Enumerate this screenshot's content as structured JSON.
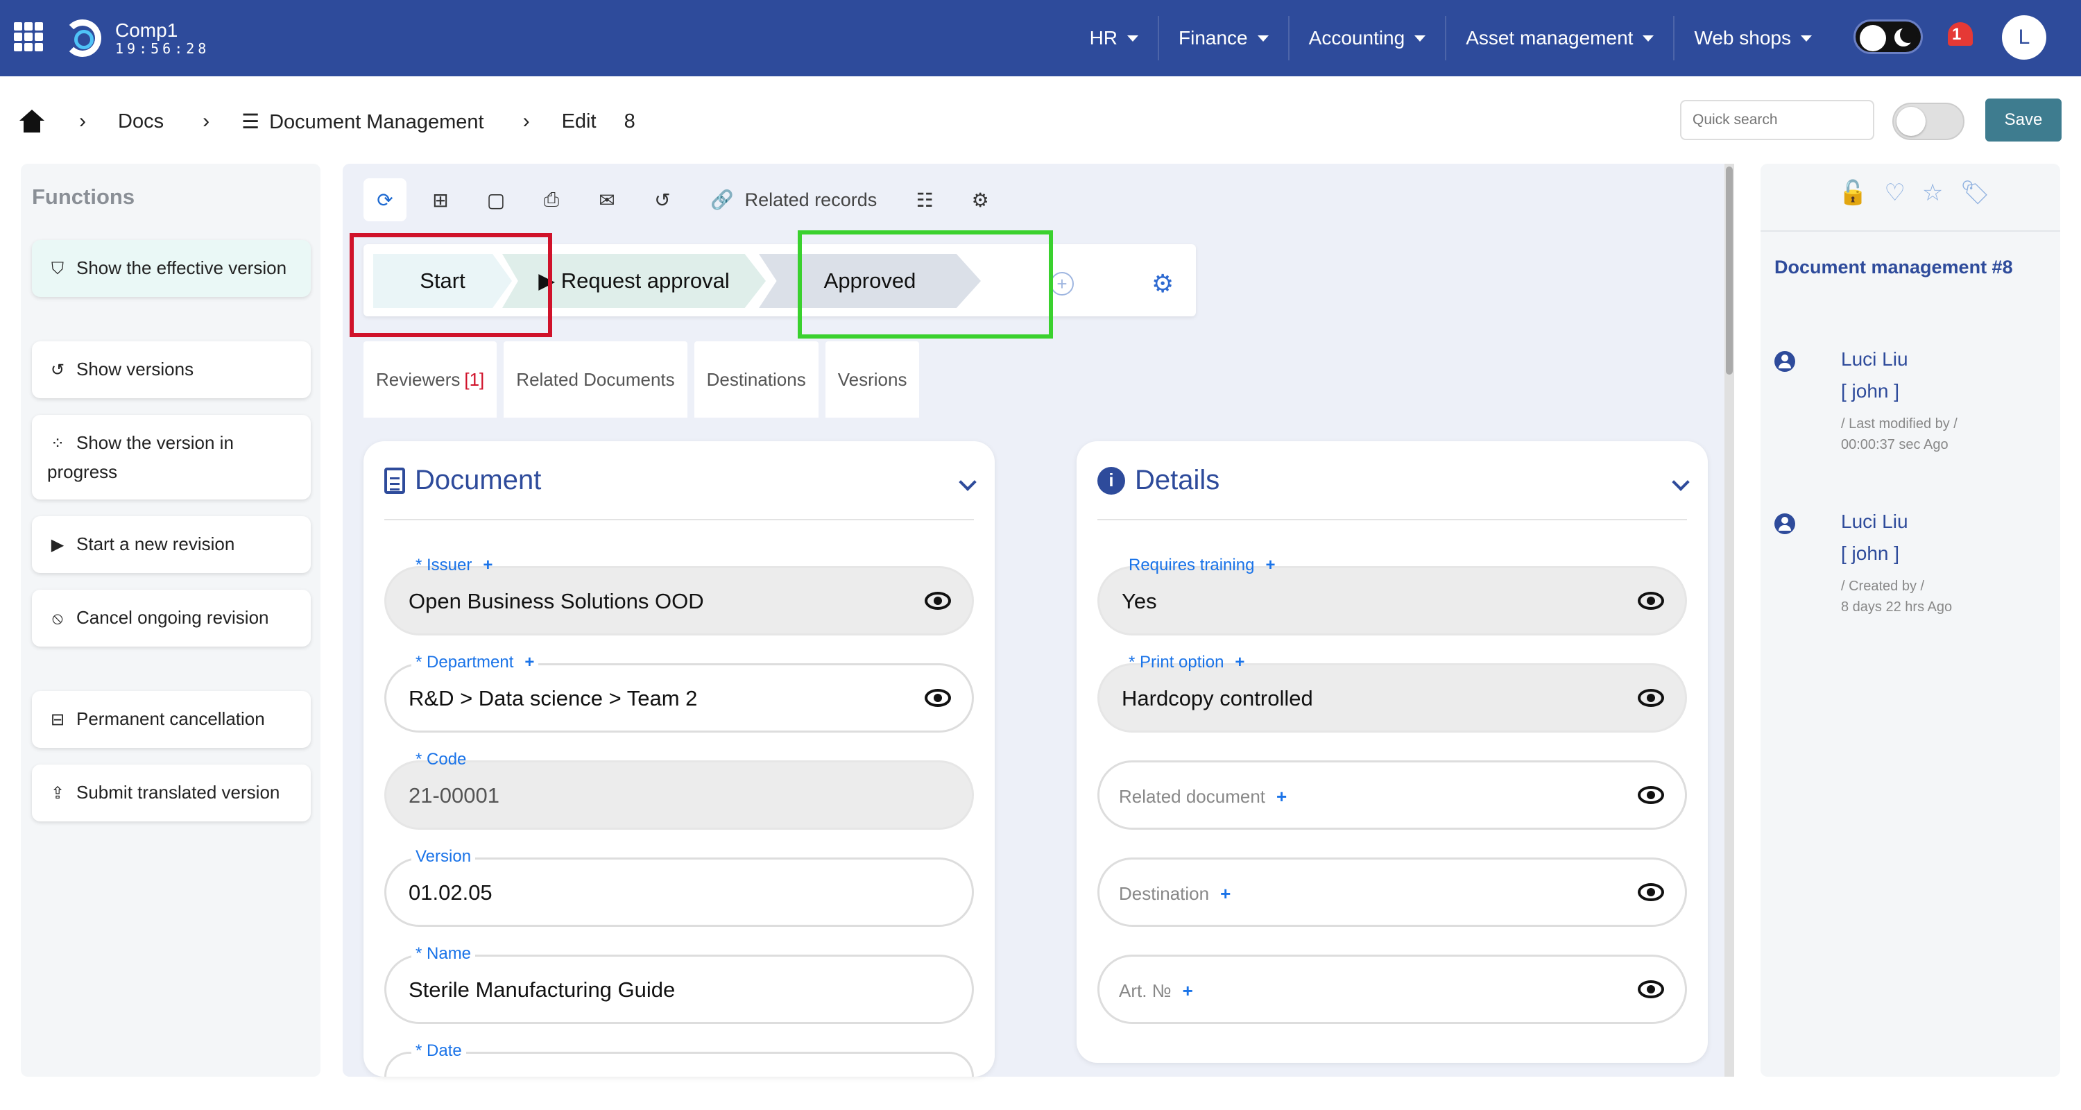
{
  "topbar": {
    "company": "Comp1",
    "time": "19:56:28",
    "nav": [
      "HR",
      "Finance",
      "Accounting",
      "Asset management",
      "Web shops"
    ],
    "notifications": "1",
    "avatar": "L"
  },
  "breadcrumb": {
    "items": [
      "Docs",
      "Document Management",
      "Edit"
    ],
    "record_id": "8"
  },
  "header": {
    "search_placeholder": "Quick search",
    "save_label": "Save"
  },
  "functions": {
    "title": "Functions",
    "items": [
      {
        "label": "Show the effective version",
        "icon": "shield-icon"
      },
      {
        "label": "Show versions",
        "icon": "history-icon"
      },
      {
        "label": "Show the version in progress",
        "icon": "spinner-icon"
      },
      {
        "label": "Start a new revision",
        "icon": "play-icon"
      },
      {
        "label": "Cancel ongoing revision",
        "icon": "ban-icon"
      },
      {
        "label": "Permanent cancellation",
        "icon": "minus-square-icon"
      },
      {
        "label": "Submit translated version",
        "icon": "upload-icon"
      }
    ]
  },
  "toolbar": {
    "related_label": "Related records"
  },
  "workflow": {
    "steps": [
      "Start",
      "▶ Request approval",
      "Approved"
    ]
  },
  "tabs": [
    {
      "label": "Reviewers",
      "badge": "[1]"
    },
    {
      "label": "Related Documents"
    },
    {
      "label": "Destinations"
    },
    {
      "label": "Vesrions"
    }
  ],
  "document": {
    "title": "Document",
    "fields": [
      {
        "label": "* Issuer",
        "value": "Open Business Solutions OOD"
      },
      {
        "label": "* Department",
        "value": "R&D > Data science > Team 2"
      },
      {
        "label": "* Code",
        "value": "21-00001"
      },
      {
        "label": "Version",
        "value": "01.02.05"
      },
      {
        "label": "* Name",
        "value": "Sterile Manufacturing Guide"
      },
      {
        "label": "* Date",
        "value": ""
      }
    ]
  },
  "details": {
    "title": "Details",
    "fields": [
      {
        "label": "Requires training",
        "value": "Yes"
      },
      {
        "label": "* Print option",
        "value": "Hardcopy controlled"
      },
      {
        "label": "Related document",
        "value": ""
      },
      {
        "label": "Destination",
        "value": ""
      },
      {
        "label": "Art. №",
        "value": ""
      }
    ]
  },
  "sidepanel": {
    "title": "Document management #8",
    "log": [
      {
        "name": "Luci Liu",
        "user": "[ john ]",
        "action": "/ Last modified by /",
        "when": "00:00:37 sec Ago"
      },
      {
        "name": "Luci Liu",
        "user": "[ john ]",
        "action": "/ Created by /",
        "when": "8 days 22 hrs Ago"
      }
    ]
  },
  "colors": {
    "topbar": "#2e4b9b",
    "accent": "#1a73e8",
    "save": "#3e7c8f",
    "highlight_red": "#d0122a",
    "highlight_green": "#3ad12e"
  }
}
